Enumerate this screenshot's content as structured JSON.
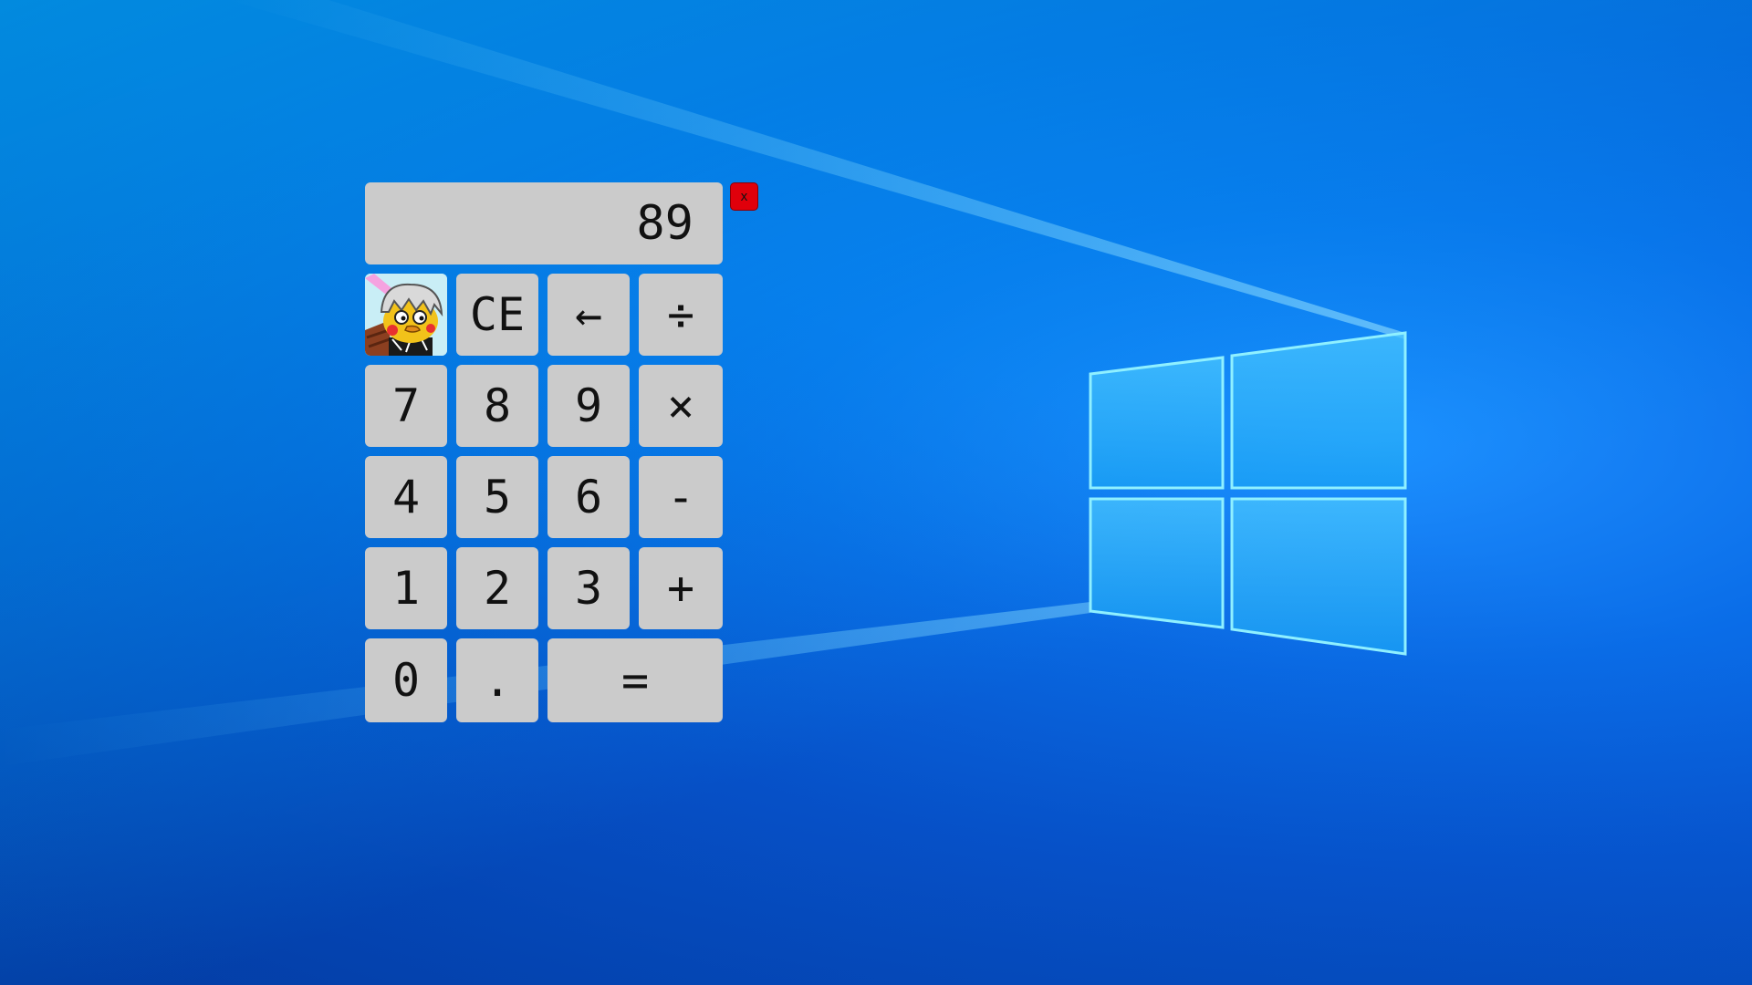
{
  "display": {
    "value": "89"
  },
  "close": {
    "label": "x"
  },
  "keys": {
    "ce": "CE",
    "back": "←",
    "divide": "÷",
    "seven": "7",
    "eight": "8",
    "nine": "9",
    "multiply": "×",
    "four": "4",
    "five": "5",
    "six": "6",
    "minus": "-",
    "one": "1",
    "two": "2",
    "three": "3",
    "plus": "+",
    "zero": "0",
    "dot": ".",
    "equals": "="
  },
  "colors": {
    "key_bg": "#cbcbcb",
    "close_bg": "#e0000b",
    "desktop_bg": "#0a6de8"
  },
  "icons": {
    "avatar": "cartoon-character-avatar",
    "logo": "windows-logo"
  }
}
